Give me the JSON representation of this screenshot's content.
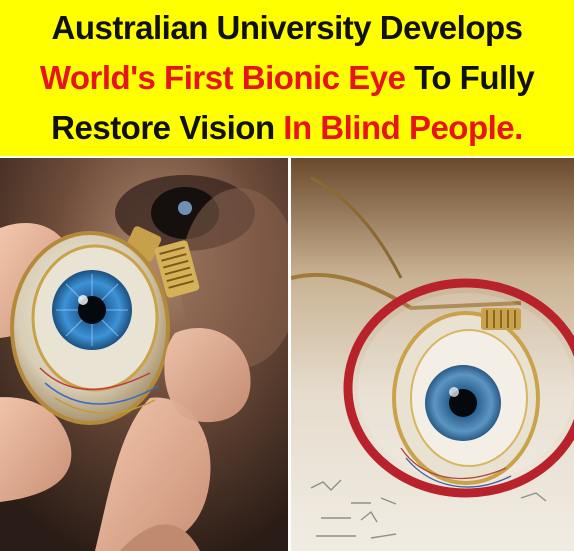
{
  "headline": {
    "line1": [
      {
        "text": "Australian University Develops",
        "color": "#111111"
      }
    ],
    "line2": [
      {
        "text": "World's First Bionic Eye",
        "color": "#e8141c"
      },
      {
        "text": " To Fully",
        "color": "#111111"
      }
    ],
    "line3": [
      {
        "text": "Restore Vision ",
        "color": "#111111"
      },
      {
        "text": "In Blind People.",
        "color": "#e8141c"
      }
    ]
  },
  "colors": {
    "banner_background": "#ffff00",
    "accent_red": "#e8141c",
    "text_dark": "#111111"
  },
  "photos": {
    "left": {
      "subject": "hand-holding-bionic-eye-prosthesis"
    },
    "right": {
      "subject": "bionic-eye-behind-eyeglasses"
    }
  }
}
